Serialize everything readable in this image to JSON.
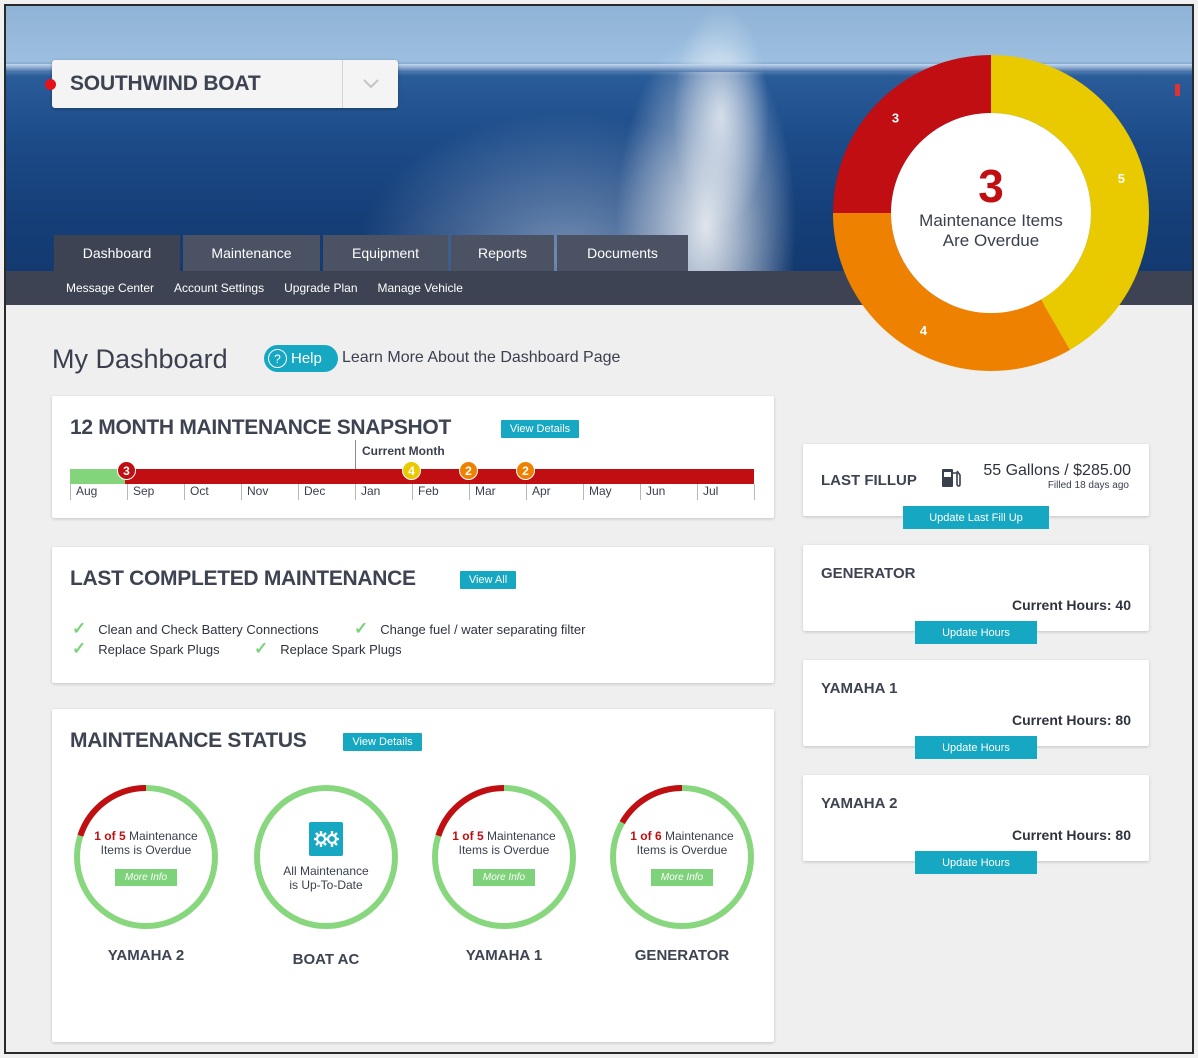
{
  "boat": {
    "name": "SOUTHWIND BOAT"
  },
  "tabs": [
    {
      "label": "Dashboard",
      "active": true
    },
    {
      "label": "Maintenance"
    },
    {
      "label": "Equipment"
    },
    {
      "label": "Reports"
    },
    {
      "label": "Documents"
    }
  ],
  "subnav": [
    "Message Center",
    "Account Settings",
    "Upgrade Plan",
    "Manage Vehicle"
  ],
  "overdue_summary": {
    "count": "3",
    "line1": "Maintenance Items",
    "line2": "Are Overdue",
    "segments": [
      {
        "label": "3",
        "value": 3,
        "color": "#c10e12"
      },
      {
        "label": "5",
        "value": 5,
        "color": "#e9c900"
      },
      {
        "label": "4",
        "value": 4,
        "color": "#ee8200"
      }
    ]
  },
  "page": {
    "title": "My Dashboard",
    "help_label": "Help",
    "help_link": "Learn More About the Dashboard Page"
  },
  "snapshot": {
    "title": "12 MONTH MAINTENANCE SNAPSHOT",
    "button": "View Details",
    "current_label": "Current Month",
    "months": [
      "Aug",
      "Sep",
      "Oct",
      "Nov",
      "Dec",
      "Jan",
      "Feb",
      "Mar",
      "Apr",
      "May",
      "Jun",
      "Jul"
    ],
    "badges": [
      {
        "month_index": 1,
        "count": "3",
        "color": "#c10e12"
      },
      {
        "month_index": 6,
        "count": "4",
        "color": "#e9c900"
      },
      {
        "month_index": 7,
        "count": "2",
        "color": "#ee8200"
      },
      {
        "month_index": 8,
        "count": "2",
        "color": "#ee8200"
      }
    ],
    "colors": {
      "completed": "#84d47c",
      "overdue": "#c10e12"
    }
  },
  "last_completed": {
    "title": "LAST COMPLETED MAINTENANCE",
    "button": "View All",
    "rows": [
      [
        "Clean and Check Battery Connections",
        "Change fuel / water separating filter"
      ],
      [
        "Replace Spark Plugs",
        "Replace Spark Plugs"
      ]
    ]
  },
  "status": {
    "title": "MAINTENANCE STATUS",
    "button": "View Details",
    "items": [
      {
        "name": "YAMAHA 2",
        "overdue": "1",
        "of": " of ",
        "total": "5",
        "text1": " Maintenance",
        "text2": "Items is Overdue",
        "more": "More Info",
        "progress": 0.2
      },
      {
        "name": "BOAT AC",
        "text1": "All Maintenance",
        "text2": "is Up-To-Date",
        "progress": 0,
        "icon": "gears-icon"
      },
      {
        "name": "YAMAHA 1",
        "overdue": "1",
        "of": " of ",
        "total": "5",
        "text1": " Maintenance",
        "text2": "Items is Overdue",
        "more": "More Info",
        "progress": 0.2
      },
      {
        "name": "GENERATOR",
        "overdue": "1",
        "of": " of ",
        "total": "6",
        "text1": " Maintenance",
        "text2": "Items is Overdue",
        "more": "More Info",
        "progress": 0.1667
      }
    ]
  },
  "fillup": {
    "title": "LAST FILLUP",
    "value": "55 Gallons / $285.00",
    "ago": "Filled 18 days ago",
    "button": "Update Last Fill Up"
  },
  "engines": [
    {
      "title": "GENERATOR",
      "hours": "Current Hours: 40",
      "button": "Update Hours"
    },
    {
      "title": "YAMAHA 1",
      "hours": "Current Hours: 80",
      "button": "Update Hours"
    },
    {
      "title": "YAMAHA 2",
      "hours": "Current Hours: 80",
      "button": "Update Hours"
    }
  ]
}
